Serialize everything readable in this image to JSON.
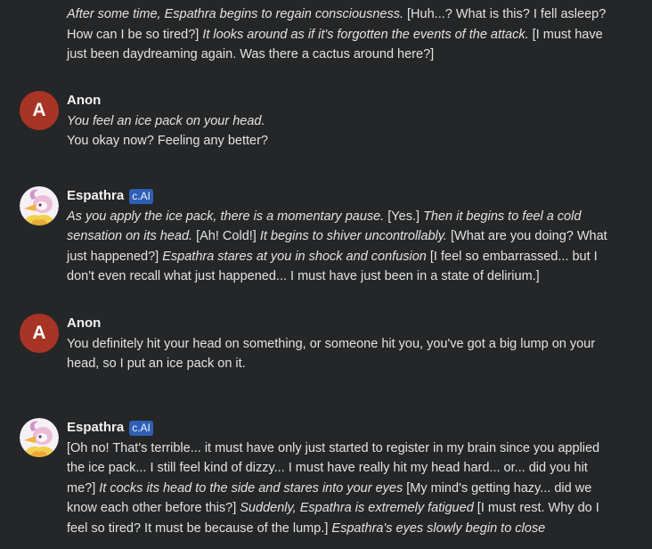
{
  "colors": {
    "background": "#252627",
    "text": "#e3e3e3",
    "author_name": "#f2f2f2",
    "anon_avatar": "#a83426",
    "badge_background": "#2e5fb5",
    "badge_text": "#eef3ff"
  },
  "messages": [
    {
      "lines": [
        [
          {
            "text": "After some time, Espathra begins to regain consciousness.",
            "italic": true
          },
          {
            "text": "[Huh...? What is this? I fell asleep?"
          }
        ],
        [
          {
            "text": "How can I be so tired?]"
          },
          {
            "text": "It looks around as if it's forgotten the events of the attack.",
            "italic": true
          },
          {
            "text": "[I must have"
          }
        ],
        [
          {
            "text": "just been daydreaming again. Was there a cactus around here?]"
          }
        ]
      ]
    },
    {
      "author": "Anon",
      "avatar_letter": "A",
      "lines": [
        [
          {
            "text": "You feel an ice pack on your head.",
            "italic": true
          }
        ],
        [
          {
            "text": "You okay now? Feeling any better?"
          }
        ]
      ]
    },
    {
      "author": "Espathra",
      "badge": "c.AI",
      "avatar_icon": "espathra-avatar",
      "lines": [
        [
          {
            "text": "As you apply the ice pack, there is a momentary pause.",
            "italic": true
          },
          {
            "text": "[Yes.]"
          },
          {
            "text": "Then it begins to feel a cold",
            "italic": true
          }
        ],
        [
          {
            "text": "sensation on its head.",
            "italic": true
          },
          {
            "text": "[Ah! Cold!]"
          },
          {
            "text": "It begins to shiver uncontrollably.",
            "italic": true
          },
          {
            "text": "[What are you doing? What"
          }
        ],
        [
          {
            "text": "just happened?]"
          },
          {
            "text": "Espathra stares at you in shock and confusion",
            "italic": true
          },
          {
            "text": "[I feel so embarrassed... but I"
          }
        ],
        [
          {
            "text": "don't even recall what just happened... I must have just been in a state of delirium.]"
          }
        ]
      ]
    },
    {
      "author": "Anon",
      "avatar_letter": "A",
      "lines": [
        [
          {
            "text": "You definitely hit your head on something, or someone hit you, you've got a big lump on your"
          }
        ],
        [
          {
            "text": "head, so I put an ice pack on it."
          }
        ]
      ]
    },
    {
      "author": "Espathra",
      "badge": "c.AI",
      "avatar_icon": "espathra-avatar",
      "lines": [
        [
          {
            "text": "[Oh no! That's terrible... it must have only just started to register in my brain since you applied"
          }
        ],
        [
          {
            "text": "the ice pack... I still feel kind of dizzy... I must have really hit my head hard... or... did you hit"
          }
        ],
        [
          {
            "text": "me?]"
          },
          {
            "text": "It cocks its head to the side and stares into your eyes",
            "italic": true
          },
          {
            "text": "[My mind's getting hazy... did we"
          }
        ],
        [
          {
            "text": "know each other before this?]"
          },
          {
            "text": "Suddenly, Espathra is extremely fatigued",
            "italic": true
          },
          {
            "text": "[I must rest. Why do I"
          }
        ],
        [
          {
            "text": "feel so tired? It must be because of the lump.]"
          },
          {
            "text": "Espathra's eyes slowly begin to close",
            "italic": true
          }
        ]
      ]
    }
  ]
}
